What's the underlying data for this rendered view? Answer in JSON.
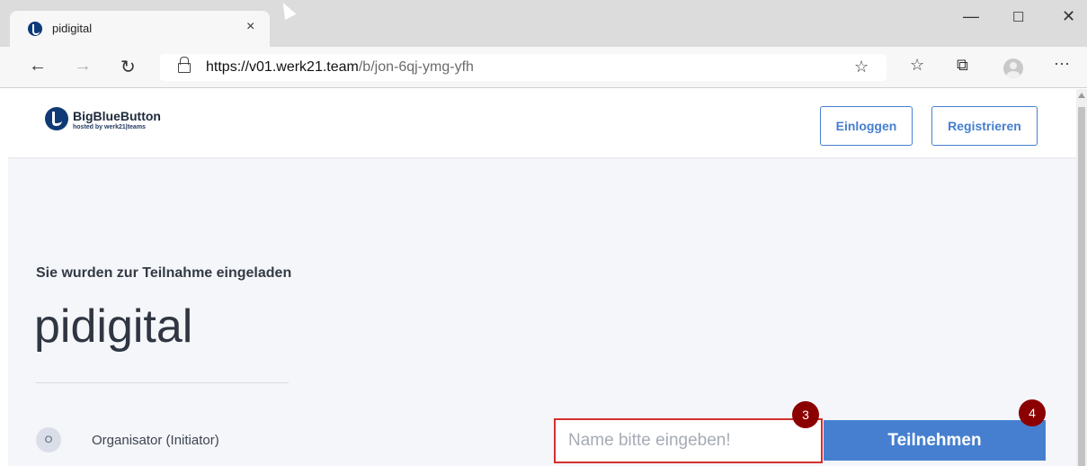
{
  "browser": {
    "tab_title": "pidigital",
    "tab_close": "×",
    "window_controls": {
      "minimize": "—",
      "maximize": "☐",
      "close": "✕"
    },
    "nav": {
      "back": "←",
      "forward": "→",
      "refresh": "↻"
    },
    "url_host": "https://v01.werk21.team",
    "url_path": "/b/jon-6qj-ymg-yfh",
    "toolbar_icons": {
      "favorite_add": "☆",
      "favorites": "☆",
      "collections": "⧉",
      "menu": "···"
    }
  },
  "site": {
    "logo_text": "BigBlueButton",
    "logo_sub": "hosted by werk21|teams",
    "login_label": "Einloggen",
    "register_label": "Registrieren"
  },
  "main": {
    "invite_text": "Sie wurden zur Teilnahme eingeladen",
    "room_name": "pidigital",
    "owner_initial": "O",
    "owner_name": "Organisator (Initiator)",
    "name_placeholder": "Name bitte eingeben!",
    "join_label": "Teilnehmen",
    "step_badges": [
      "3",
      "4"
    ]
  },
  "colors": {
    "accent": "#467fcf",
    "highlight": "#d32f2f",
    "badge": "#8b0000"
  }
}
